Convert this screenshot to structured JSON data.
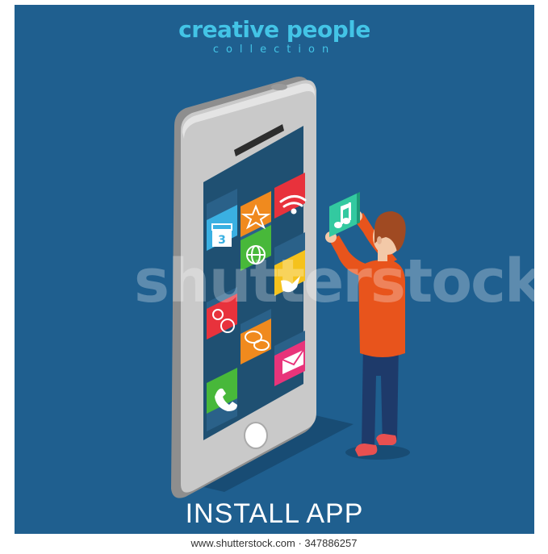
{
  "brand": {
    "title": "creative people",
    "subtitle": "collection"
  },
  "scene": {
    "calendar_day": "3",
    "tile_icons": [
      "calendar-icon",
      "star-icon",
      "wifi-icon",
      "globe-icon",
      "bird-icon",
      "gears-icon",
      "chat-icon",
      "mail-icon",
      "phone-icon",
      "music-note-icon"
    ]
  },
  "caption": "INSTALL APP",
  "watermark": "shutterstock",
  "footer": {
    "url": "www.shutterstock.com · 347886257"
  },
  "colors": {
    "background": "#1f5f8f",
    "brand_text": "#43c4e6",
    "phone_body": "#c8c8c8",
    "screen": "#1f5072",
    "tile_calendar": "#3ab0e2",
    "tile_star": "#f08a1e",
    "tile_wifi": "#e8323c",
    "tile_globe": "#48b83a",
    "tile_bird": "#f5c21c",
    "tile_gears": "#e8323c",
    "tile_chat": "#f08a1e",
    "tile_mail": "#e8347a",
    "tile_phone": "#48b83a",
    "tile_music": "#33c9a0",
    "shirt": "#e8541c",
    "pants": "#1e3a6a",
    "shoes": "#e85050",
    "hair": "#a04a22"
  }
}
